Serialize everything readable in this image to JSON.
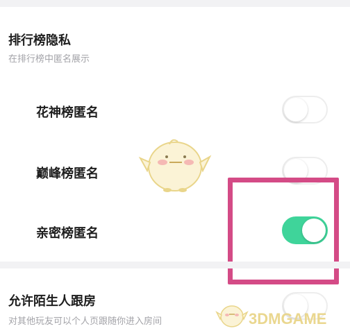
{
  "privacy": {
    "title": "排行榜隐私",
    "subtitle": "在排行榜中匿名展示"
  },
  "rows": [
    {
      "label": "花神榜匿名",
      "enabled": false
    },
    {
      "label": "巅峰榜匿名",
      "enabled": false
    },
    {
      "label": "亲密榜匿名",
      "enabled": true
    }
  ],
  "follow": {
    "title": "允许陌生人跟房",
    "subtitle": "对其他玩友可以个人页跟随你进入房间",
    "enabled": false
  },
  "watermark": {
    "text": "3DMGAME"
  },
  "colors": {
    "toggle_on": "#3fd49a",
    "highlight": "#d44b86"
  }
}
